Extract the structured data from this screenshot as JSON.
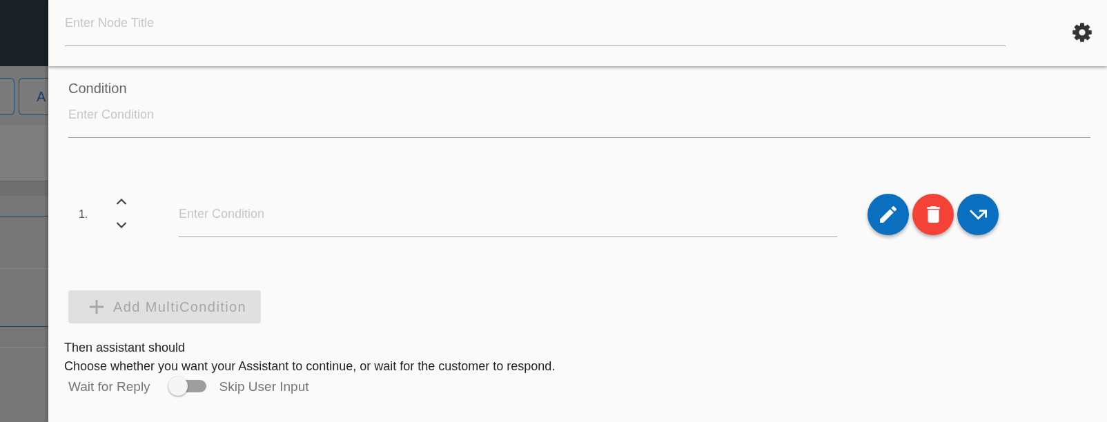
{
  "backdrop": {
    "button_label": "A"
  },
  "header": {
    "title_field": {
      "placeholder": "Enter Node Title"
    }
  },
  "condition": {
    "label": "Condition",
    "placeholder": "Enter Condition"
  },
  "multi_conditions": [
    {
      "number": "1.",
      "placeholder": "Enter Condition",
      "actions": [
        {
          "kind": "edit"
        },
        {
          "kind": "delete"
        },
        {
          "kind": "redirect"
        }
      ]
    }
  ],
  "add_button": {
    "label": "Add MultiCondition",
    "disabled": true
  },
  "response": {
    "heading": "Then assistant should",
    "description": "Choose whether you want your Assistant to continue, or wait for the customer to respond."
  },
  "toggle": {
    "left_label": "Wait for Reply",
    "right_label": "Skip User Input",
    "on": false
  }
}
